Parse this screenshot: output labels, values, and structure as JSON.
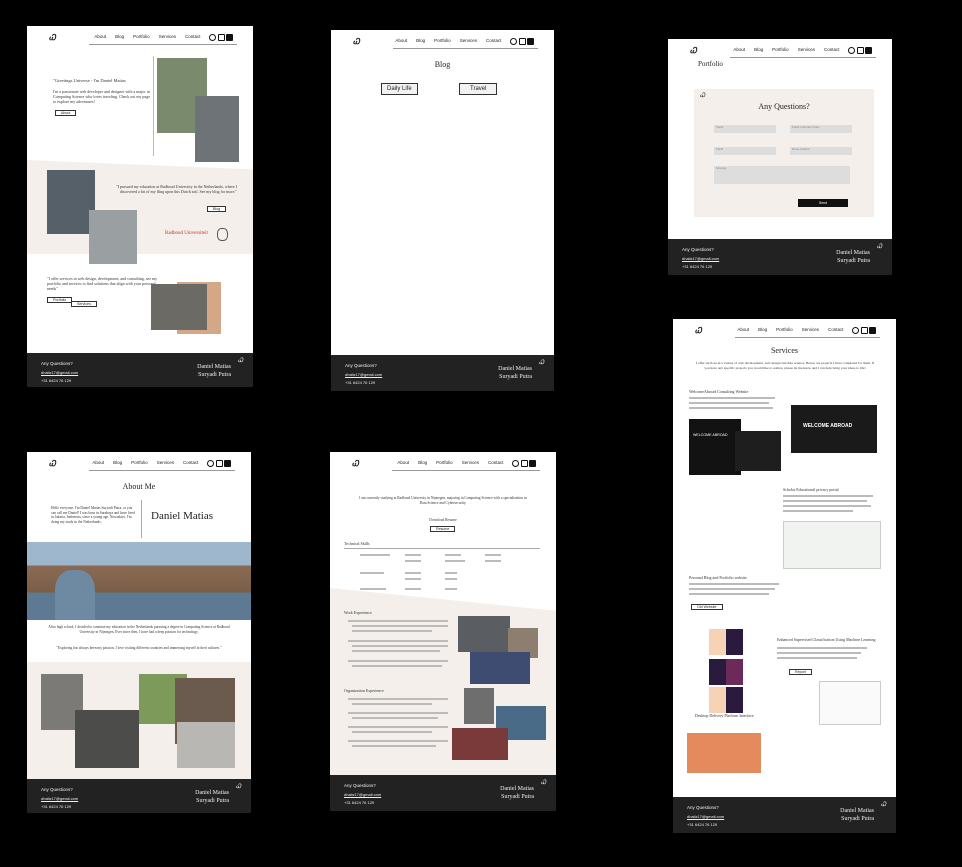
{
  "nav": {
    "logo": "Ꮗ",
    "links": [
      "About",
      "Blog",
      "Portfolio",
      "Services",
      "Contact"
    ]
  },
  "footer": {
    "question": "Any Questions?",
    "email": "dhaliz17@gmail.com",
    "phone": "+31 6424 76 129",
    "name_line1": "Daniel Matias",
    "name_line2": "Suryadi Putra"
  },
  "home": {
    "greeting": "\"Greetings Universe - I'm Daniel Matias",
    "intro": "I'm a passionate web developer and designer with a major in Computing Science who loves traveling. Check out my page to explore my adventures!",
    "about_btn": "About",
    "quote_radboud": "\"I pursued my education at Radboud University in the Netherlands, where I discovered a bit of my fling upon this Dutch soil. See my blog for more.\"",
    "blog_btn": "Blog",
    "radboud_logo": "Radboud Universiteit",
    "quote_services": "\"I offer services in web design, development, and consulting, see my portfolio and services to find solutions that align with your personal needs\"",
    "portfolio_btn": "Portfolio",
    "services_btn": "Services"
  },
  "blog": {
    "title": "Blog",
    "categories": [
      "Daily Life",
      "Travel"
    ]
  },
  "portfolio": {
    "title": "Portfolio",
    "form_title": "Any Questions?",
    "fields": [
      "Name",
      "Email/Customer Name",
      "Email",
      "Phone Number",
      "Message"
    ],
    "send": "Send"
  },
  "about": {
    "title": "About Me",
    "bio": "Hello everyone, I'm Daniel Matias Suryadi Putra, or you can call me Daniel! I was born in Surabaya and have lived in Jakarta, Indonesia, since a young age. Nowadays, I'm doing my study in the Netherlands.",
    "name": "Daniel Matias",
    "story": "After high school, I decided to continue my education in the Netherlands pursuing a degree in Computing Science at Radboud University in Nijmegen. Ever since then, I have had a deep passion for technology.",
    "quote": "\"Exploring has always been my passion. I love visiting different countries and immersing myself in their cultures.\""
  },
  "resume": {
    "summary": "I am currently studying at Radboud University in Nijmegen, majoring in Computing Science with a specialization in Data Science and Cybersecurity.",
    "download_label": "Download Resume",
    "download_btn": "Resume",
    "skills_title": "Technical Skills",
    "work_title": "Work Experience",
    "org_title": "Organization Experience"
  },
  "services": {
    "title": "Services",
    "intro": "I offer services in a variety of web development, web design and data science. Below are projects I have completed for them. If you have any specific projects you would like to realize, please let me know and I can help bring your ideas to life!",
    "projects": [
      {
        "name": "WelcomeAbroad Consulting Website",
        "banner": "WELCOME ABROAD"
      },
      {
        "name": "Scholar Educational privacy portal"
      },
      {
        "name": "Personal Blog and Portfolio website",
        "btn": "Old Website"
      },
      {
        "name": "Enhanced Supervised Classification Using Machine Learning",
        "btn": "Report"
      },
      {
        "name": "Desktop Delivery Platform Interface"
      }
    ]
  },
  "colors": {
    "beige": "#f4efea",
    "footer": "#222222",
    "photo": "#6b6e70",
    "accent_orange": "#e58a5d",
    "radboud_red": "#c0392b"
  }
}
